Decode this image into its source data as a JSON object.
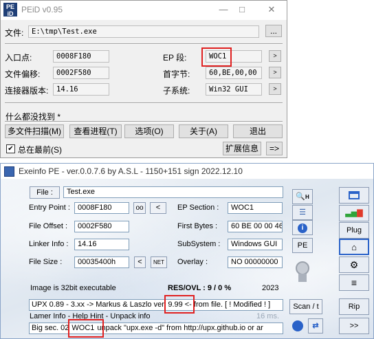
{
  "peid": {
    "title": "PEiD v0.95",
    "logo_text": "PE iD",
    "file_label": "文件:",
    "file_path": "E:\\tmp\\Test.exe",
    "browse_label": "...",
    "fields": {
      "entry_point": {
        "label": "入口点:",
        "value": "0008F180"
      },
      "file_offset": {
        "label": "文件偏移:",
        "value": "0002F580"
      },
      "linker_version": {
        "label": "连接器版本:",
        "value": "14.16"
      },
      "ep_section": {
        "label": "EP 段:",
        "value": "WOC1"
      },
      "first_bytes": {
        "label": "首字节:",
        "value": "60,BE,00,00"
      },
      "subsystem": {
        "label": "子系统:",
        "value": "Win32 GUI"
      }
    },
    "arrow": ">",
    "result_text": "什么都没找到  *",
    "buttons": {
      "multi_scan": "多文件扫描(M)",
      "view_process": "查看进程(T)",
      "options": "选项(O)",
      "about": "关于(A)",
      "exit": "退出",
      "plugins": "扩展信息",
      "more": "=>"
    },
    "always_on_top": {
      "label": "总在最前(S)",
      "checked": true
    }
  },
  "exeinfo": {
    "title": "Exeinfo PE - ver.0.0.7.6  by A.S.L  -  1150+151 sign  2022.12.10",
    "file_button": "File :",
    "file_name": "Test.exe",
    "entry_point": {
      "label": "Entry Point :",
      "value": "0008F180",
      "button": "oo",
      "arrow": "<"
    },
    "ep_section": {
      "label": "EP Section :",
      "value": "WOC1"
    },
    "file_offset": {
      "label": "File Offset :",
      "value": "0002F580"
    },
    "first_bytes": {
      "label": "First Bytes :",
      "value": "60 BE 00 00 46"
    },
    "linker_info": {
      "label": "Linker Info :",
      "value": "14.16"
    },
    "subsystem": {
      "label": "SubSystem :",
      "value": "Windows GUI"
    },
    "file_size": {
      "label": "File Size :",
      "value": "00035400h",
      "arrow": "<",
      "net": "NET"
    },
    "overlay": {
      "label": "Overlay :",
      "value": "NO  00000000"
    },
    "image_info": "Image is 32bit executable",
    "res_ovl": "RES/OVL : 9 / 0 %",
    "year": "2023",
    "detect_line_pre": "UPX 0.89 - 3.xx -> Markus & Laszlo ver.",
    "detect_version": "9.99",
    "detect_line_post": "<- from file. [ ! Modified ! ]",
    "hint_line": "Lamer Info - Help Hint - Unpack info",
    "timing": "16 ms.",
    "unpack_pre": "Big sec. 02",
    "unpack_section": "WOC1",
    "unpack_post": "unpack \"upx.exe -d\"  from  http://upx.github.io or ar",
    "side_buttons": {
      "h": "H",
      "pe": "PE",
      "plug": "Plug",
      "scan": "Scan / t",
      "rip": "Rip",
      "next": ">>"
    }
  }
}
